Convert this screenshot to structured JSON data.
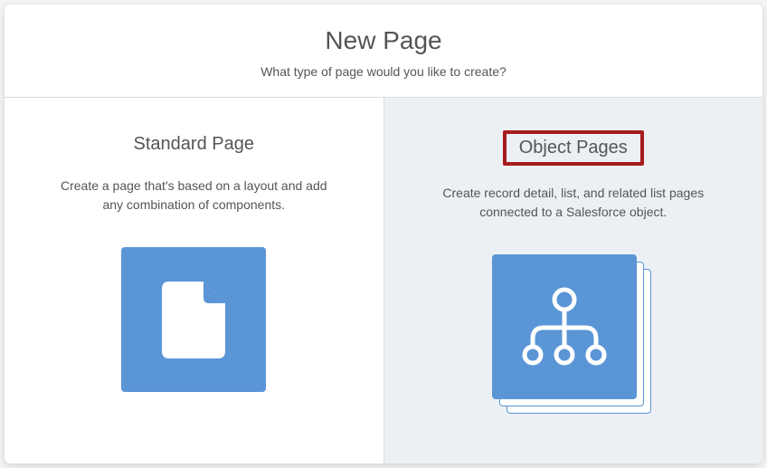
{
  "header": {
    "title": "New Page",
    "subtitle": "What type of page would you like to create?"
  },
  "options": {
    "standard": {
      "title": "Standard Page",
      "description": "Create a page that's based on a layout and add any combination of components."
    },
    "object": {
      "title": "Object Pages",
      "description": "Create record detail, list, and related list pages connected to a Salesforce object."
    }
  }
}
